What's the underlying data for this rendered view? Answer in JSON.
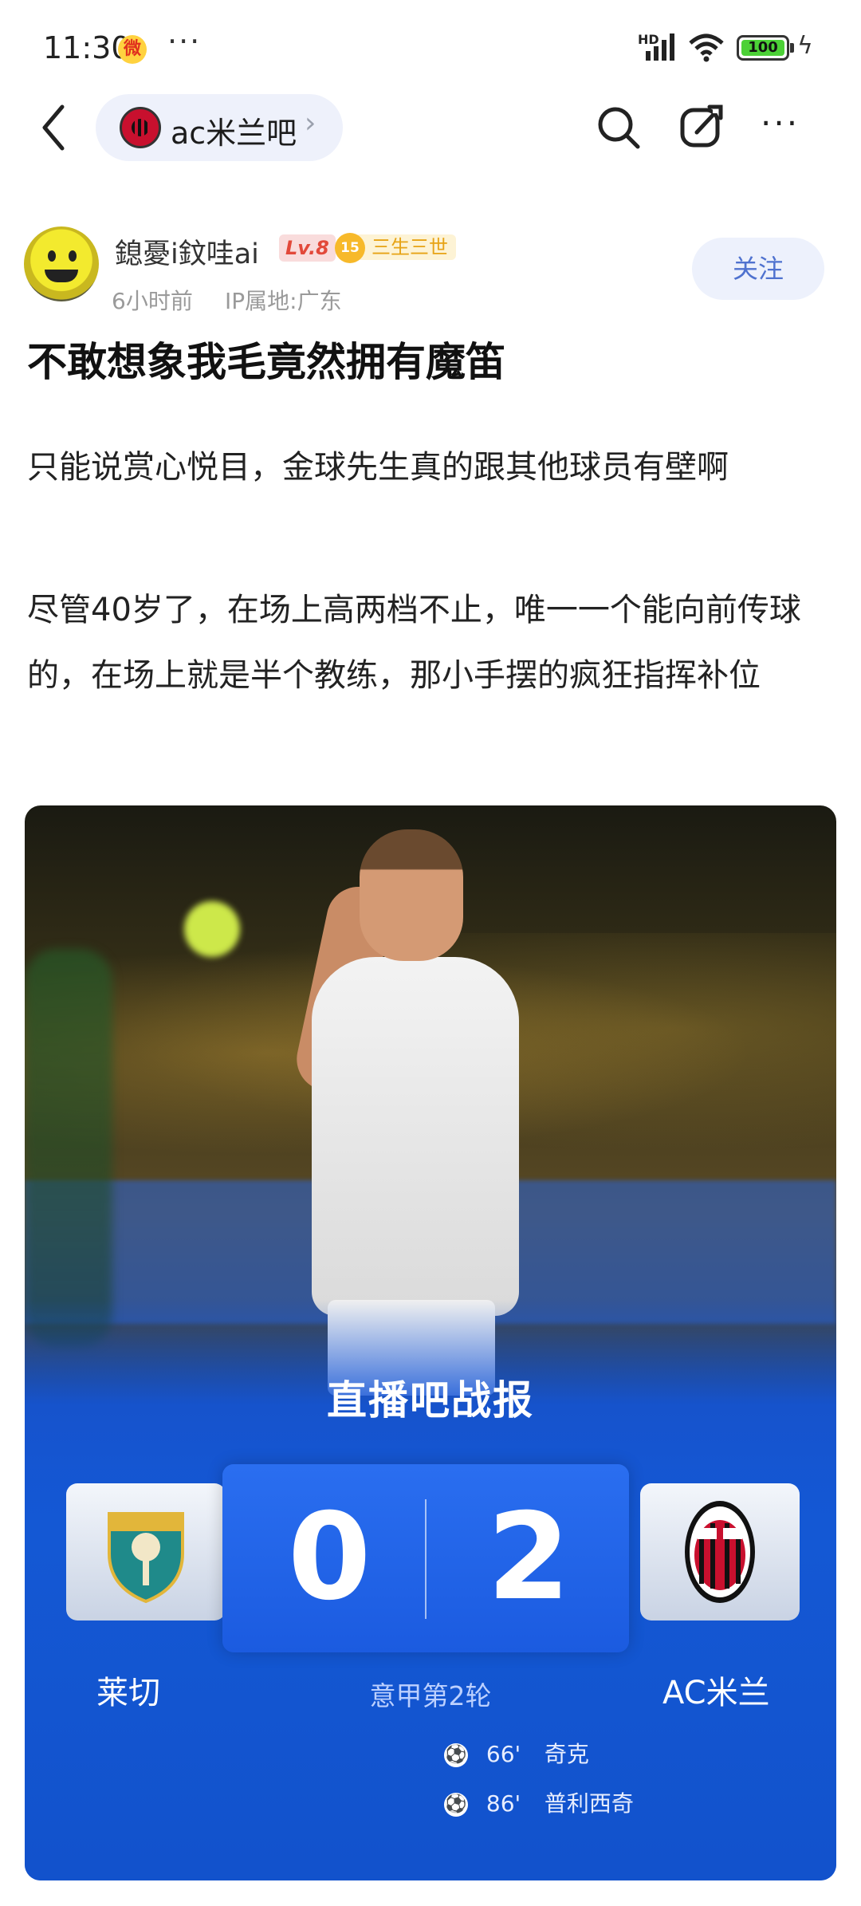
{
  "status": {
    "time": "11:30",
    "battery": "100",
    "network": "HD"
  },
  "nav": {
    "forum_name": "ac米兰吧"
  },
  "author": {
    "name": "鎴憂i鈫哇ai",
    "level": "Lv.8",
    "fan_level": "15",
    "fan_title": "三生三世",
    "time_ago": "6小时前",
    "ip_location": "IP属地:广东",
    "follow_label": "关注"
  },
  "post": {
    "title": "不敢想象我毛竟然拥有魔笛",
    "paragraph1": "只能说赏心悦目，金球先生真的跟其他球员有壁啊",
    "paragraph2": "尽管40岁了，在场上高两档不止，唯一一个能向前传球的，在场上就是半个教练，那小手摆的疯狂指挥补位"
  },
  "match_card": {
    "title": "直播吧战报",
    "home_team": "莱切",
    "away_team": "AC米兰",
    "home_score": "0",
    "away_score": "2",
    "round": "意甲第2轮",
    "goals": [
      {
        "minute": "66'",
        "scorer": "奇克"
      },
      {
        "minute": "86'",
        "scorer": "普利西奇"
      }
    ]
  },
  "colors": {
    "accent_blue": "#4f72cf",
    "card_blue": "#1458d4",
    "level_red": "#e2493a",
    "fan_gold": "#e7a315"
  }
}
